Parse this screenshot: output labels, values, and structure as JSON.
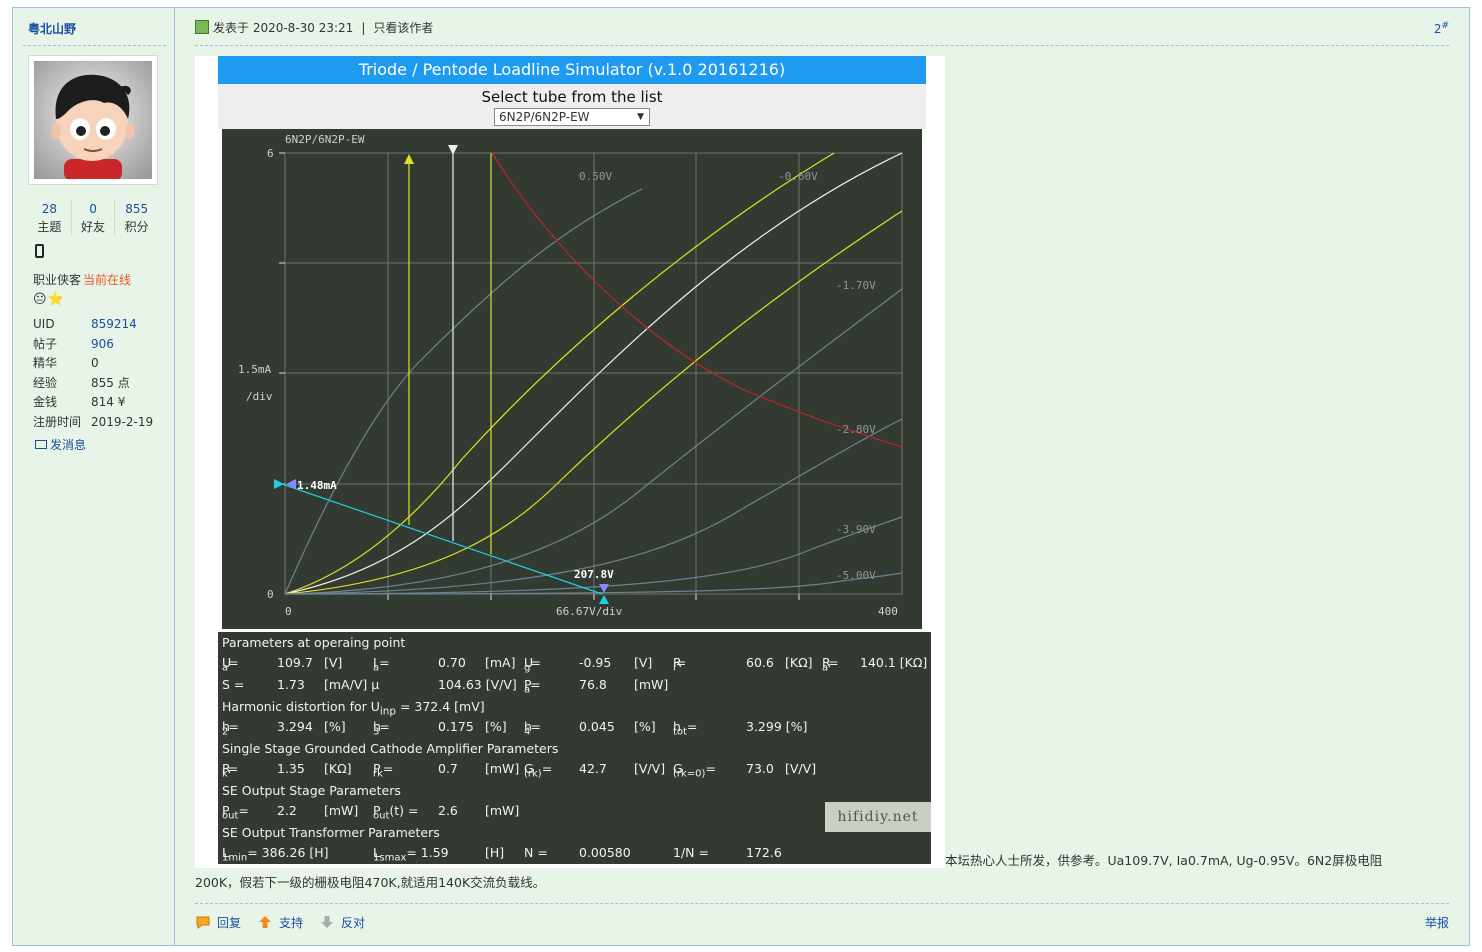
{
  "author": {
    "name": "粤北山野"
  },
  "stats": [
    {
      "value": "28",
      "label": "主题"
    },
    {
      "value": "0",
      "label": "好友"
    },
    {
      "value": "855",
      "label": "积分"
    }
  ],
  "group": {
    "title": "职业侠客",
    "status": "当前在线"
  },
  "medals": "😐⭐",
  "profile": [
    {
      "key": "UID",
      "value": "859214"
    },
    {
      "key": "帖子",
      "value": "906"
    },
    {
      "key": "精华",
      "value": "0"
    },
    {
      "key": "经验",
      "value": "855 点"
    },
    {
      "key": "金钱",
      "value": "814 ¥"
    },
    {
      "key": "注册时间",
      "value": "2019-2-19"
    }
  ],
  "send_message": "发消息",
  "post": {
    "time": "发表于 2020-8-30 23:21",
    "only_author": "只看该作者",
    "floor": "2",
    "floor_mark": "#",
    "text_line1": "本坛热心人士所发，供参考。Ua109.7V, Ia0.7mA, Ug-0.95V。6N2屏极电阻",
    "text_line2": "200K，假若下一级的栅极电阻470K,就适用140K交流负载线。"
  },
  "sim": {
    "title": "Triode / Pentode Loadline Simulator (v.1.0 20161216)",
    "select_label": "Select tube from the list",
    "tube": "6N2P/6N2P-EW",
    "plot_title": "6N2P/6N2P-EW",
    "y_top": "6",
    "y_zero": "0",
    "y_unit1": "1.5mA",
    "y_unit2": "/div",
    "x_zero": "0",
    "x_unit": "66.67V/div",
    "x_max": "400",
    "curve_labels": [
      "0.50V",
      "-0.60V",
      "-1.70V",
      "-2.80V",
      "-3.90V",
      "-5.00V"
    ],
    "ia_marker": "1.48mA",
    "ua_marker": "207.8V",
    "watermark": "hifidiy.net"
  },
  "params": {
    "op_title": "Parameters at operaing point",
    "ua_label": "U",
    "ua_sub": "a",
    "ua_eq": "=",
    "ua": "109.7",
    "ua_unit": "[V]",
    "ia_label": "I",
    "ia_sub": "a",
    "ia_eq": "=",
    "ia": "0.70",
    "ia_unit": "[mA]",
    "ug_label": "U",
    "ug_sub": "g",
    "ug_eq": "=",
    "ug": "-0.95",
    "ug_unit": "[V]",
    "ri_label": "R",
    "ri_sub": "i",
    "ri_eq": "=",
    "ri": "60.6",
    "ri_unit": "[KΩ]",
    "ra_label": "R",
    "ra_sub": "a",
    "ra_eq": "=",
    "ra": "140.1 [KΩ]",
    "s_label": "S =",
    "s": "1.73",
    "s_unit": "[mA/V] μ",
    "mu": "104.63 [V/V]",
    "pa_label": "P",
    "pa_sub": "a",
    "pa_eq": "=",
    "pa": "76.8",
    "pa_unit": "[mW]",
    "hd_title": "Harmonic distortion for U",
    "hd_sub": "inp",
    "hd_rest": " = 372.4 [mV]",
    "h2_label": "h",
    "h2_sub": "2",
    "h2_eq": "=",
    "h2": "3.294",
    "h2_unit": "[%]",
    "h3_label": "h",
    "h3_sub": "3",
    "h3_eq": "=",
    "h3": "0.175",
    "h3_unit": "[%]",
    "h4_label": "h",
    "h4_sub": "4",
    "h4_eq": "=",
    "h4": "0.045",
    "h4_unit": "[%]",
    "htot_label": "h",
    "htot_sub": "tot",
    "htot_eq": "=",
    "htot": "3.299 [%]",
    "se_title": "Single Stage Grounded Cathode Amplifier Parameters",
    "rk_label": "R",
    "rk_sub": "k",
    "rk_eq": "=",
    "rk": "1.35",
    "rk_unit": "[KΩ]",
    "prk_label": "P",
    "prk_sub": "rk",
    "prk_eq": "=",
    "prk": "0.7",
    "prk_unit": "[mW]",
    "g_label": "G",
    "g_sub": "(rk)",
    "g_eq": "=",
    "g": "42.7",
    "g_unit": "[V/V]",
    "g0_label": "G",
    "g0_sub": "(rk=0)",
    "g0_eq": "=",
    "g0": "73.0",
    "g0_unit": "[V/V]",
    "out_title": "SE Output Stage Parameters",
    "pout_label": "P",
    "pout_sub": "out",
    "pout_eq": "=",
    "pout": "2.2",
    "pout_unit": "[mW]",
    "poutt_label": "P",
    "poutt_sub": "out",
    "poutt_rest": "(t) =",
    "poutt": "2.6",
    "poutt_unit": "[mW]",
    "tr_title": "SE Output Transformer Parameters",
    "l1_label": "L",
    "l1_sub": "1min",
    "l1_rest": "= 386.26 [H]",
    "l2_label": "L",
    "l2_sub": "1smax",
    "l2_rest": "= 1.59",
    "l2_unit": "[H]",
    "n_label": "N =",
    "n": "0.00580",
    "inv_label": "1/N =",
    "inv": "172.6"
  },
  "actions": {
    "reply": "回复",
    "support": "支持",
    "oppose": "反对",
    "report": "举报"
  },
  "colors": {
    "accent": "#1e9af0",
    "link": "#1a4fa0",
    "plot_bg": "#333a32",
    "online": "#e05a2b"
  }
}
